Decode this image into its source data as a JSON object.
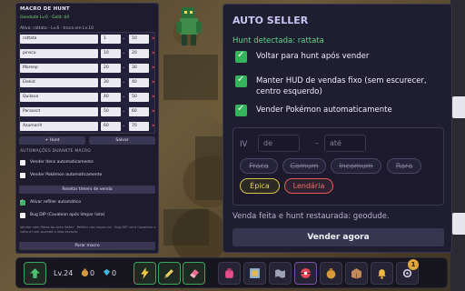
{
  "macro": {
    "title": "MACRO DE HUNT",
    "geodude_info": "Geodude Lv.6 · Gold: $0",
    "active_info": "Ativo: rattata · Lv.6 · troca em Lv.10",
    "hunts": [
      {
        "name": "rattata",
        "min": "1",
        "max": "10"
      },
      {
        "name": "pinsco",
        "min": "10",
        "max": "20"
      },
      {
        "name": "Mareep",
        "min": "20",
        "max": "30"
      },
      {
        "name": "Elekid",
        "min": "30",
        "max": "40"
      },
      {
        "name": "Quilava",
        "min": "40",
        "max": "50"
      },
      {
        "name": "Parasect",
        "min": "50",
        "max": "60"
      },
      {
        "name": "Azumarill",
        "min": "60",
        "max": "70"
      }
    ],
    "add_hunt": "+ Hunt",
    "save": "Salvar",
    "section_automations": "AUTOMAÇÕES DURANTE MACRO",
    "opt_sell_items": "Vender itens automaticamente",
    "opt_sell_pokemon": "Vender Pokémon automaticamente",
    "reset_timers": "Resetar timers de venda",
    "opt_refill": "Ativar refiller automático",
    "opt_bug_dip": "Bug DIP (Cavalean após limpar lista)",
    "note": "Vender com filtros do Auto Seller · Refiller usa regras do · Bug DIP vai e Cavalean e volta à hunt quando a lista esvazia.",
    "stop": "Parar macro",
    "sell_items_checked": false,
    "sell_pokemon_checked": false,
    "refill_checked": true,
    "bug_dip_checked": false
  },
  "seller": {
    "title": "AUTO SELLER",
    "detected": "Hunt detectada: rattata",
    "options": [
      {
        "label": "Voltar para hunt após vender",
        "checked": true
      },
      {
        "label": "Manter HUD de vendas fixo (sem escurecer, centro esquerdo)",
        "checked": true
      },
      {
        "label": "Vender Pokémon automaticamente",
        "checked": true
      }
    ],
    "iv_label": "IV",
    "iv_from_placeholder": "de",
    "iv_to_placeholder": "até",
    "iv_dash": "–",
    "rarities": [
      {
        "label": "Fraca",
        "active": false
      },
      {
        "label": "Comum",
        "active": false
      },
      {
        "label": "Incomum",
        "active": false
      },
      {
        "label": "Rara",
        "active": false
      },
      {
        "label": "Épica",
        "active": true
      },
      {
        "label": "Lendária",
        "active": true
      }
    ],
    "status": "Venda feita e hunt restaurada: geodude.",
    "sell_now": "Vender agora"
  },
  "hud": {
    "level": "Lv.24",
    "gold": "0",
    "gems": "0",
    "notifications": "1"
  },
  "colors": {
    "accent_green": "#34b45b",
    "panel_bg": "#1f1d30",
    "epic": "#e9d65a",
    "legendary": "#ef6a6a"
  }
}
